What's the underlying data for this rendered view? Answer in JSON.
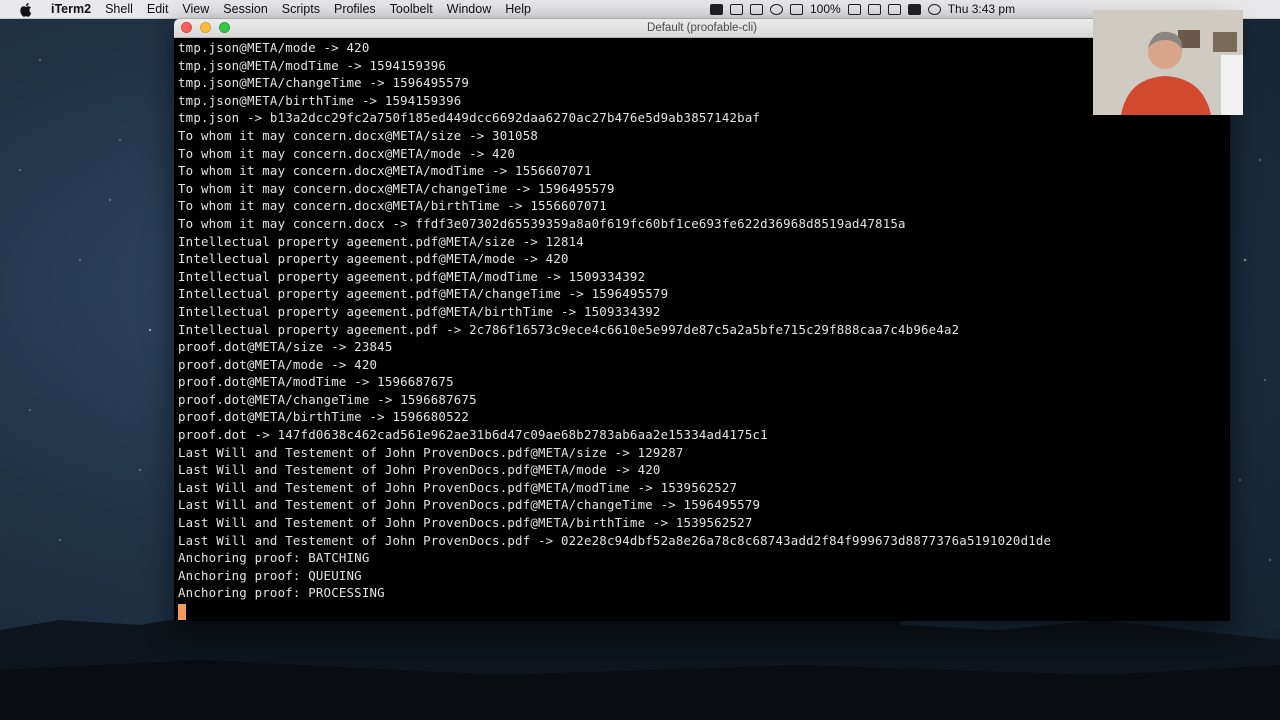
{
  "menubar": {
    "app_name": "iTerm2",
    "items": [
      "Shell",
      "Edit",
      "View",
      "Session",
      "Scripts",
      "Profiles",
      "Toolbelt",
      "Window",
      "Help"
    ],
    "battery": "100%",
    "clock": "Thu 3:43 pm"
  },
  "window": {
    "title": "Default (proofable-cli)"
  },
  "terminal": {
    "lines": [
      "tmp.json@META/mode -> 420",
      "tmp.json@META/modTime -> 1594159396",
      "tmp.json@META/changeTime -> 1596495579",
      "tmp.json@META/birthTime -> 1594159396",
      "tmp.json -> b13a2dcc29fc2a750f185ed449dcc6692daa6270ac27b476e5d9ab3857142baf",
      "To whom it may concern.docx@META/size -> 301058",
      "To whom it may concern.docx@META/mode -> 420",
      "To whom it may concern.docx@META/modTime -> 1556607071",
      "To whom it may concern.docx@META/changeTime -> 1596495579",
      "To whom it may concern.docx@META/birthTime -> 1556607071",
      "To whom it may concern.docx -> ffdf3e07302d65539359a8a0f619fc60bf1ce693fe622d36968d8519ad47815a",
      "Intellectual property ageement.pdf@META/size -> 12814",
      "Intellectual property ageement.pdf@META/mode -> 420",
      "Intellectual property ageement.pdf@META/modTime -> 1509334392",
      "Intellectual property ageement.pdf@META/changeTime -> 1596495579",
      "Intellectual property ageement.pdf@META/birthTime -> 1509334392",
      "Intellectual property ageement.pdf -> 2c786f16573c9ece4c6610e5e997de87c5a2a5bfe715c29f888caa7c4b96e4a2",
      "proof.dot@META/size -> 23845",
      "proof.dot@META/mode -> 420",
      "proof.dot@META/modTime -> 1596687675",
      "proof.dot@META/changeTime -> 1596687675",
      "proof.dot@META/birthTime -> 1596680522",
      "proof.dot -> 147fd0638c462cad561e962ae31b6d47c09ae68b2783ab6aa2e15334ad4175c1",
      "Last Will and Testement of John ProvenDocs.pdf@META/size -> 129287",
      "Last Will and Testement of John ProvenDocs.pdf@META/mode -> 420",
      "Last Will and Testement of John ProvenDocs.pdf@META/modTime -> 1539562527",
      "Last Will and Testement of John ProvenDocs.pdf@META/changeTime -> 1596495579",
      "Last Will and Testement of John ProvenDocs.pdf@META/birthTime -> 1539562527",
      "Last Will and Testement of John ProvenDocs.pdf -> 022e28c94dbf52a8e26a78c8c68743add2f84f999673d8877376a5191020d1de",
      "Anchoring proof: BATCHING",
      "Anchoring proof: QUEUING",
      "Anchoring proof: PROCESSING"
    ],
    "cursor_color": "#f39a58"
  },
  "colors": {
    "terminal_bg": "#000000",
    "terminal_fg": "#e3e3e3",
    "menubar_bg": "#e8e8ea"
  }
}
